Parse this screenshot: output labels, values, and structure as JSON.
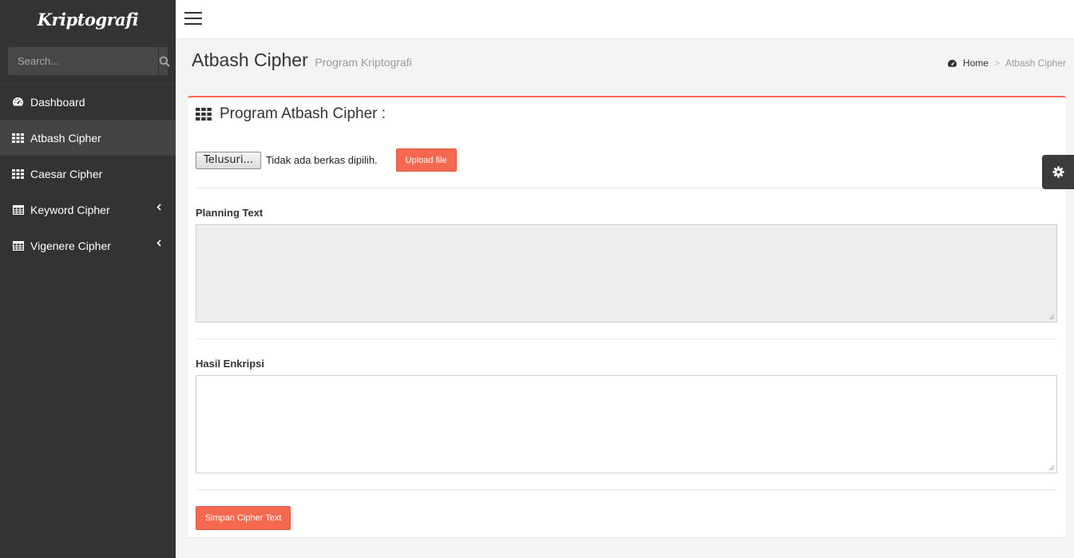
{
  "app": {
    "brand": "Kriptografi"
  },
  "sidebar": {
    "search_placeholder": "Search...",
    "items": [
      {
        "label": "Dashboard",
        "icon": "dashboard-icon"
      },
      {
        "label": "Atbash Cipher",
        "icon": "grid-icon",
        "active": true
      },
      {
        "label": "Caesar Cipher",
        "icon": "grid-icon"
      },
      {
        "label": "Keyword Cipher",
        "icon": "table-icon",
        "has_submenu": true
      },
      {
        "label": "Vigenere Cipher",
        "icon": "table-icon",
        "has_submenu": true
      }
    ]
  },
  "header": {
    "title": "Atbash Cipher",
    "subtitle": "Program Kriptografi",
    "breadcrumb": {
      "home": "Home",
      "divider": ">",
      "current": "Atbash Cipher"
    }
  },
  "box": {
    "title": "Program Atbash Cipher :",
    "file_button": "Telusuri...",
    "file_status": "Tidak ada berkas dipilih.",
    "upload_button": "Upload file",
    "planning_label": "Planning Text",
    "planning_value": "",
    "result_label": "Hasil Enkripsi",
    "result_value": "",
    "save_button": "Simpan Cipher Text"
  },
  "colors": {
    "sidebar_bg": "#333333",
    "sidebar_active": "#444444",
    "accent": "#f4694f",
    "settings_tab": "#3c3c3c"
  }
}
